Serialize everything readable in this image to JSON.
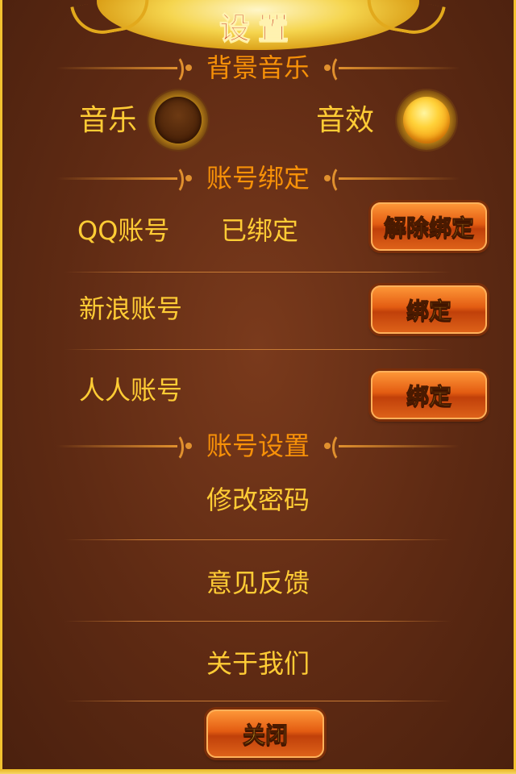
{
  "title": "设置",
  "sections": {
    "music": "背景音乐",
    "binding": "账号绑定",
    "account": "账号设置"
  },
  "audio": {
    "music_label": "音乐",
    "music_on": false,
    "effects_label": "音效",
    "effects_on": true
  },
  "accounts": [
    {
      "label": "QQ账号",
      "status": "已绑定",
      "button": "解除绑定"
    },
    {
      "label": "新浪账号",
      "status": "",
      "button": "绑定"
    },
    {
      "label": "人人账号",
      "status": "",
      "button": "绑定"
    }
  ],
  "menu": [
    "修改密码",
    "意见反馈",
    "关于我们"
  ],
  "close_button": "关闭",
  "colors": {
    "label": "#FFCC35",
    "section": "#F79108"
  }
}
